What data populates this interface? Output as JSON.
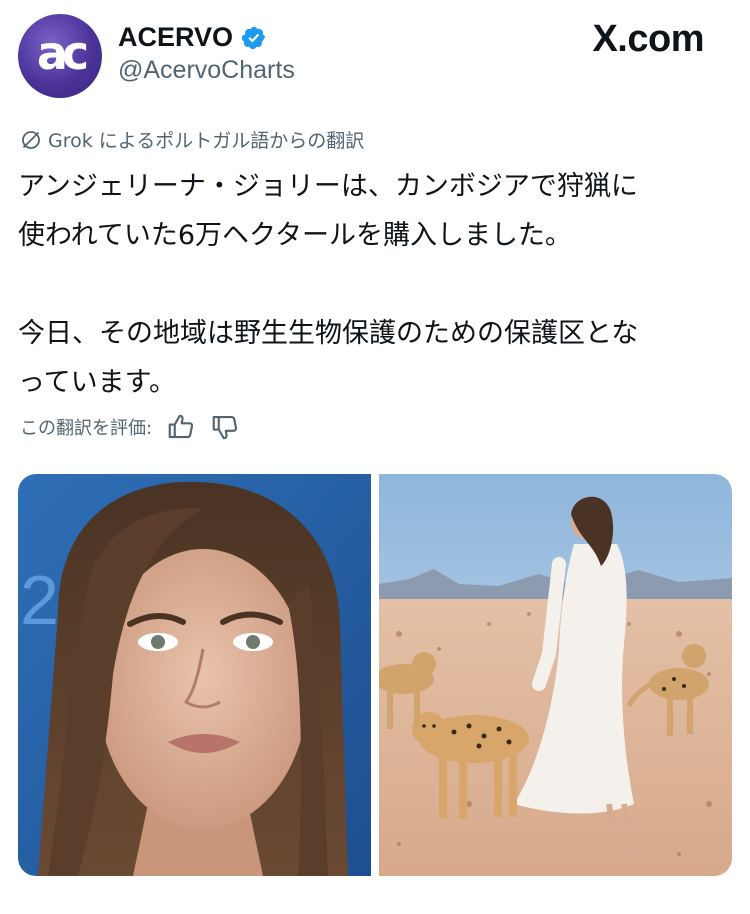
{
  "header": {
    "avatar_text": "ac",
    "display_name": "ACERVO",
    "handle": "@AcervoCharts",
    "brand": "X.com",
    "avatar_color": "#4b3399",
    "verified_color": "#1d9bf0"
  },
  "translation": {
    "label": "Grok によるポルトガル語からの翻訳",
    "icon": "translate-icon"
  },
  "post": {
    "line1": "アンジェリーナ・ジョリーは、カンボジアで狩猟に",
    "line2": "使われていた6万ヘクタールを購入しました。",
    "line3": "今日、その地域は野生生物保護のための保護区とな",
    "line4": "っています。"
  },
  "rate": {
    "label": "この翻訳を評価:",
    "thumbs_up_icon": "thumbs-up-icon",
    "thumbs_down_icon": "thumbs-down-icon"
  },
  "media": {
    "image1_alt_icon": "portrait-photo",
    "image2_alt_icon": "desert-cheetahs-photo"
  }
}
